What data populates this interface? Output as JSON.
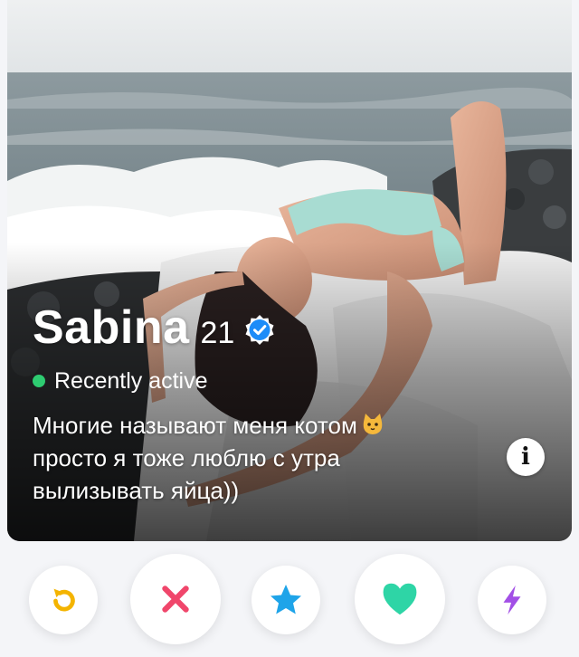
{
  "profile": {
    "name": "Sabina",
    "age": "21",
    "verified": true,
    "status": "Recently active",
    "bio_line1": "Многие называют меня котом",
    "bio_emoji": "cat-face-icon",
    "bio_line2": "просто я тоже люблю с утра",
    "bio_line3": "вылизывать яйца))"
  },
  "info_button": {
    "icon": "info-icon",
    "label": "i"
  },
  "actions": [
    {
      "id": "rewind",
      "icon": "rewind-icon",
      "color": "#f4b400"
    },
    {
      "id": "nope",
      "icon": "close-icon",
      "color": "#f0466b"
    },
    {
      "id": "super-like",
      "icon": "star-icon",
      "color": "#1ea4e9"
    },
    {
      "id": "like",
      "icon": "heart-icon",
      "color": "#2ed5a6"
    },
    {
      "id": "boost",
      "icon": "lightning-icon",
      "color": "#a24fe6"
    }
  ],
  "colors": {
    "status_dot": "#2ecc71",
    "verified_badge": "#1d8cf8"
  }
}
